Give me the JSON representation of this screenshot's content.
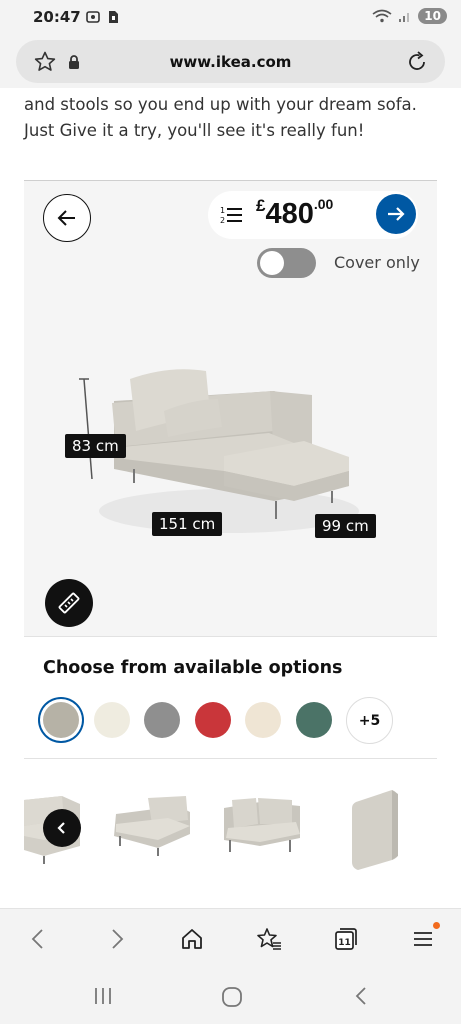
{
  "status_bar": {
    "time": "20:47",
    "battery": "10"
  },
  "browser": {
    "url": "www.ikea.com",
    "tab_count": "11"
  },
  "intro_text": "and stools so you end up with your dream sofa. Just Give it a try, you'll see it's really fun!",
  "configurator": {
    "price": {
      "currency": "£",
      "whole": "480",
      "decimal": ".00"
    },
    "toggle_label": "Cover only",
    "toggle_on": false,
    "dimensions": {
      "height": "83 cm",
      "width": "151 cm",
      "depth": "99 cm"
    }
  },
  "options": {
    "title": "Choose from available options",
    "swatches": [
      {
        "name": "beige-grey",
        "color": "#b6b2a6",
        "selected": true
      },
      {
        "name": "off-white",
        "color": "#efece0",
        "selected": false
      },
      {
        "name": "grey",
        "color": "#8f8f8f",
        "selected": false
      },
      {
        "name": "red",
        "color": "#c9363a",
        "selected": false
      },
      {
        "name": "cream",
        "color": "#efe5d4",
        "selected": false
      },
      {
        "name": "green",
        "color": "#4b7367",
        "selected": false
      }
    ],
    "more_label": "+5"
  },
  "colors": {
    "accent": "#0058a3",
    "dark": "#111111",
    "panel": "#f5f5f5"
  }
}
